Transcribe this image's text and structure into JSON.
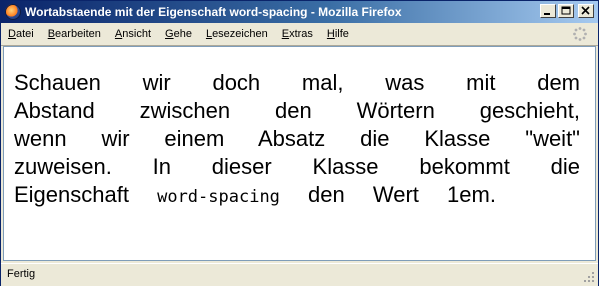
{
  "window": {
    "title": "Wortabstaende mit der Eigenschaft word-spacing - Mozilla Firefox"
  },
  "menu": {
    "items": [
      {
        "accel": "D",
        "rest": "atei"
      },
      {
        "accel": "B",
        "rest": "earbeiten"
      },
      {
        "accel": "A",
        "rest": "nsicht"
      },
      {
        "accel": "G",
        "rest": "ehe"
      },
      {
        "accel": "L",
        "rest": "esezeichen"
      },
      {
        "accel": "E",
        "rest": "xtras"
      },
      {
        "accel": "H",
        "rest": "ilfe"
      }
    ]
  },
  "content": {
    "text_before": "Schauen wir doch mal, was mit dem Abstand zwischen den Wörtern geschieht, wenn wir einem Absatz die Klasse \"weit\" zuweisen. In dieser Klasse bekommt die Eigenschaft",
    "code": "word-spacing",
    "text_after": "den Wert 1em."
  },
  "status": {
    "text": "Fertig"
  },
  "colors": {
    "title_start": "#0a246a",
    "title_end": "#a6caf0",
    "chrome": "#ece9d8",
    "page_bg": "#ffffff"
  }
}
